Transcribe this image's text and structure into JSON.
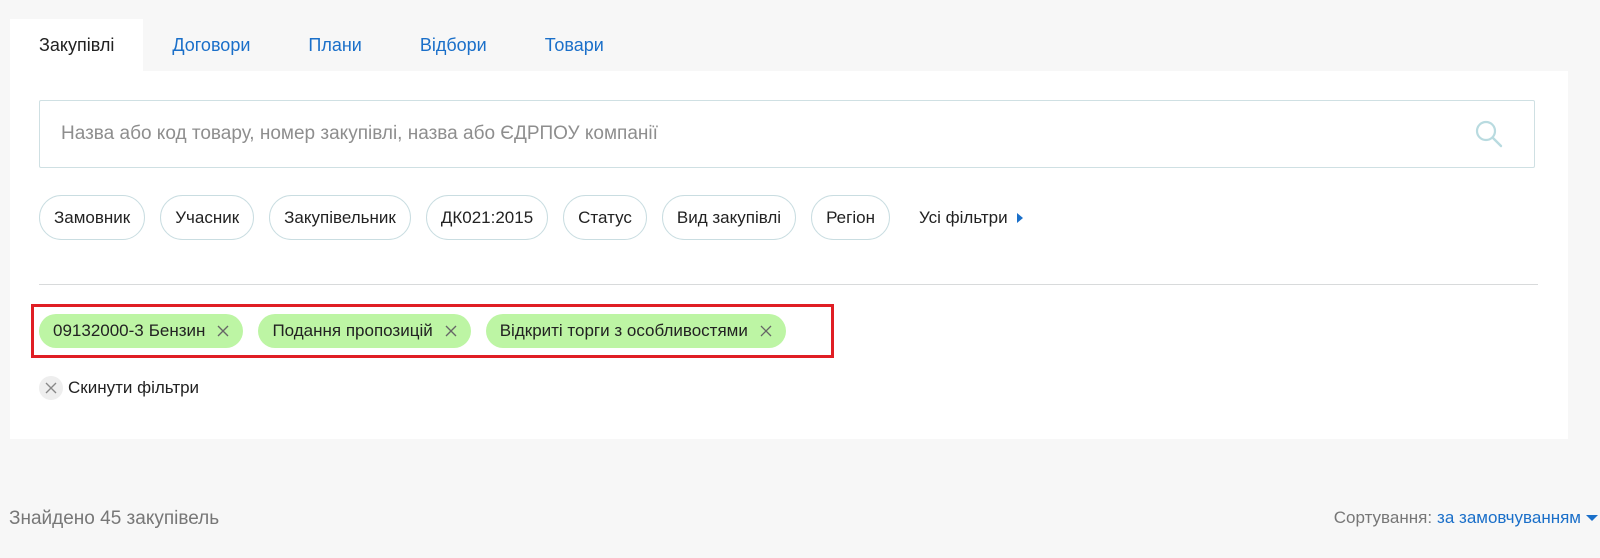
{
  "tabs": [
    {
      "label": "Закупівлі",
      "active": true
    },
    {
      "label": "Договори"
    },
    {
      "label": "Плани"
    },
    {
      "label": "Відбори"
    },
    {
      "label": "Товари"
    }
  ],
  "search": {
    "placeholder": "Назва або код товару, номер закупівлі, назва або ЄДРПОУ компанії",
    "value": ""
  },
  "filters": [
    "Замовник",
    "Учасник",
    "Закупівельник",
    "ДК021:2015",
    "Статус",
    "Вид закупівлі",
    "Регіон"
  ],
  "all_filters_label": "Усі фільтри",
  "applied_filters": [
    {
      "code": "09132000-3",
      "label": "Бензин"
    },
    {
      "label": "Подання пропозицій"
    },
    {
      "label": "Відкриті торги з особливостями"
    }
  ],
  "reset_label": "Скинути фільтри",
  "results": {
    "found_text": "Знайдено 45 закупівель"
  },
  "sort": {
    "label": "Сортування:",
    "value": "за замовчуванням"
  },
  "colors": {
    "accent": "#1a6fc9",
    "tag_bg": "#bdf5a4",
    "highlight": "#e01e24"
  }
}
